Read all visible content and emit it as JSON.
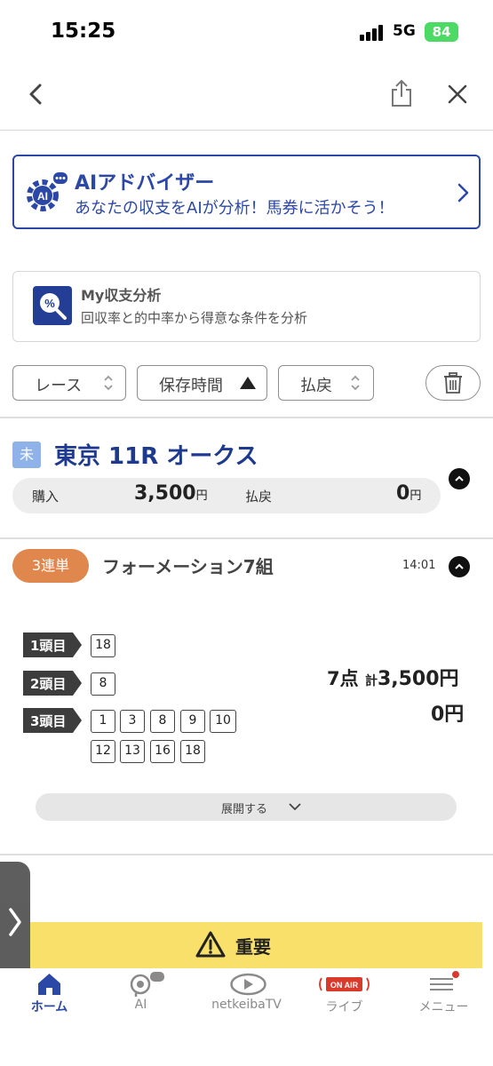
{
  "status_bar": {
    "time": "15:25",
    "network": "5G",
    "battery": "84"
  },
  "ai_advisor": {
    "title": "AIアドバイザー",
    "subtitle": "あなたの収支をAIが分析！馬券に活かそう！",
    "badge": "AI"
  },
  "my_analysis": {
    "title": "My収支分析",
    "subtitle": "回収率と的中率から得意な条件を分析",
    "icon_symbol": "%"
  },
  "filters": {
    "race_label": "レース",
    "time_label": "保存時間",
    "payout_label": "払戻"
  },
  "race": {
    "status_badge": "未",
    "title": "東京 11R オークス",
    "purchase_label": "購入",
    "purchase_value": "3,500",
    "purchase_unit": "円",
    "payout_label": "払戻",
    "payout_value": "0",
    "payout_unit": "円"
  },
  "bet": {
    "type": "3連単",
    "title": "フォーメーション7組",
    "time": "14:01",
    "positions": [
      {
        "label": "1頭目",
        "numbers": [
          "18"
        ]
      },
      {
        "label": "2頭目",
        "numbers": [
          "8"
        ]
      },
      {
        "label": "3頭目",
        "numbers": [
          "1",
          "3",
          "8",
          "9",
          "10",
          "12",
          "13",
          "16",
          "18"
        ]
      }
    ],
    "points": "7点",
    "total_prefix": "計",
    "total": "3,500円",
    "payout": "0円",
    "expand_label": "展開する"
  },
  "notice": {
    "label": "重要"
  },
  "tabbar": {
    "items": [
      {
        "label": "ホーム",
        "icon": "home-icon"
      },
      {
        "label": "AI",
        "icon": "ai-head-icon"
      },
      {
        "label": "netkeibaTV",
        "icon": "tv-play-icon"
      },
      {
        "label": "ライブ",
        "icon": "on-air-icon",
        "badge": "ON AIR"
      },
      {
        "label": "メニュー",
        "icon": "menu-icon"
      }
    ]
  },
  "colors": {
    "brand_blue": "#2c48a6",
    "bet_orange": "#e0874e",
    "notice_yellow": "#f8e06a",
    "status_badge": "#8fb3e8",
    "on_air_red": "#d93a2b"
  }
}
